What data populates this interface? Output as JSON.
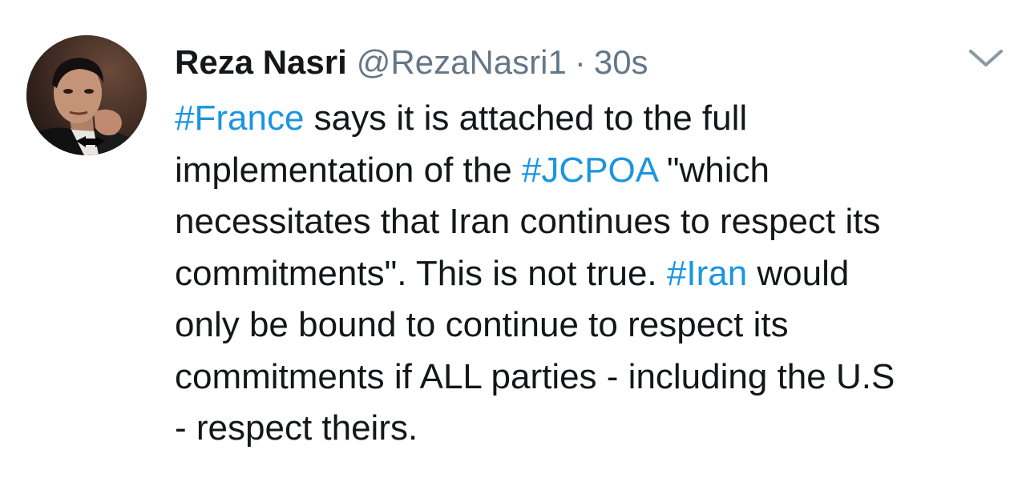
{
  "tweet": {
    "author_name": "Reza Nasri",
    "handle": "@RezaNasri1",
    "separator": "·",
    "time": "30s",
    "menu_icon": "chevron-down-icon",
    "avatar_icon": "profile-photo",
    "hashtag_color": "#1b95e0",
    "text_color": "#14171a",
    "muted_color": "#657786",
    "lines": [
      [
        {
          "text": "#France",
          "hashtag": true
        },
        {
          "text": " says it is attached to the full",
          "hashtag": false
        }
      ],
      [
        {
          "text": "implementation of the ",
          "hashtag": false
        },
        {
          "text": "#JCPOA",
          "hashtag": true
        },
        {
          "text": " \"which",
          "hashtag": false
        }
      ],
      [
        {
          "text": "necessitates that Iran continues to respect its",
          "hashtag": false
        }
      ],
      [
        {
          "text": "commitments\". This is not true. ",
          "hashtag": false
        },
        {
          "text": "#Iran",
          "hashtag": true
        },
        {
          "text": " would",
          "hashtag": false
        }
      ],
      [
        {
          "text": "only be bound to continue to respect its",
          "hashtag": false
        }
      ],
      [
        {
          "text": "commitments if ALL parties - including the U.S",
          "hashtag": false
        }
      ],
      [
        {
          "text": "- respect theirs.",
          "hashtag": false
        }
      ]
    ]
  }
}
